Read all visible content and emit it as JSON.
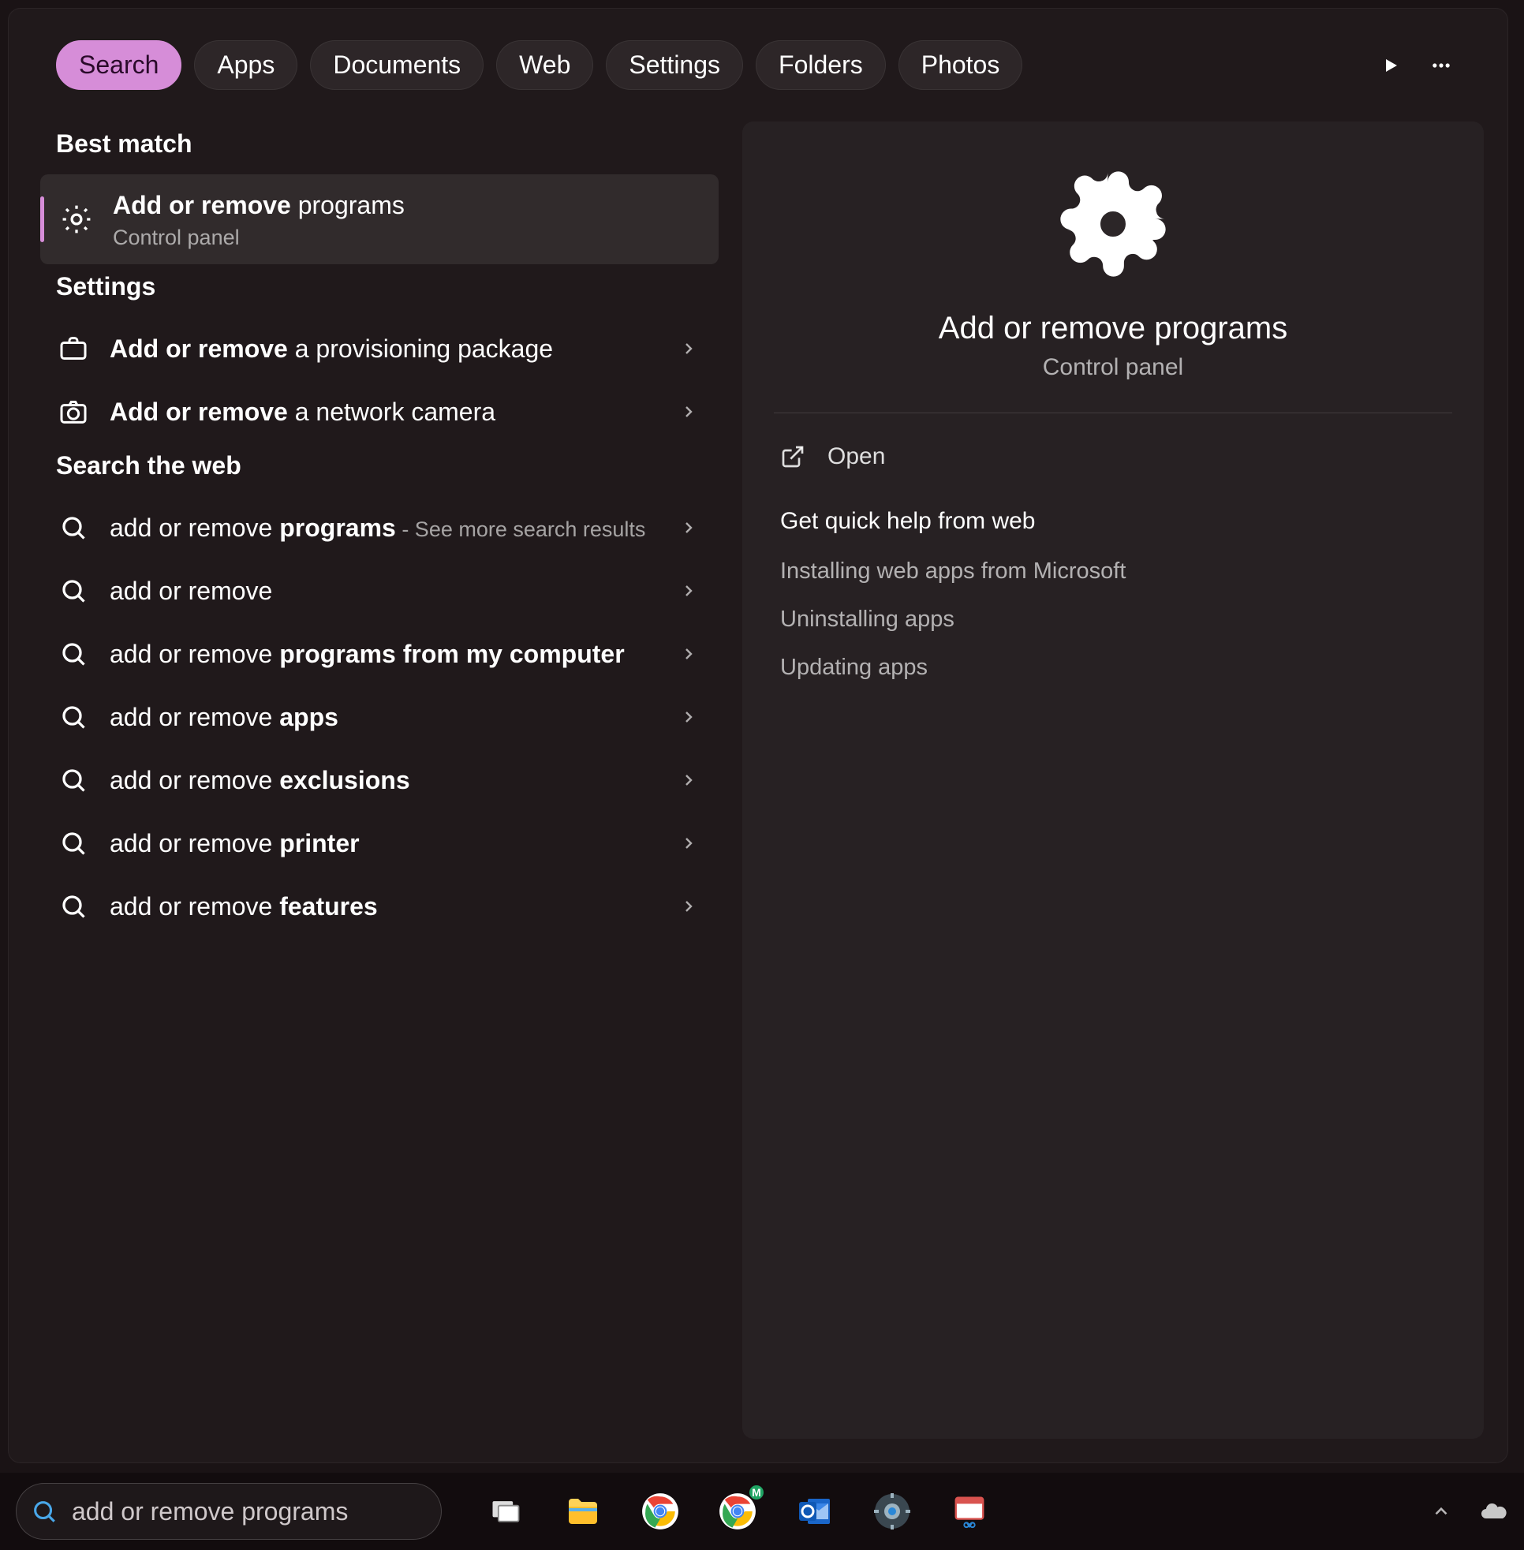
{
  "tabs": [
    "Search",
    "Apps",
    "Documents",
    "Web",
    "Settings",
    "Folders",
    "Photos"
  ],
  "active_tab_index": 0,
  "left": {
    "best_match_header": "Best match",
    "best_match": {
      "title_bold": "Add or remove",
      "title_rest": " programs",
      "subtitle": "Control panel"
    },
    "settings_header": "Settings",
    "settings_items": [
      {
        "bold": "Add or remove",
        "rest": " a provisioning package",
        "icon": "briefcase"
      },
      {
        "bold": "Add or remove",
        "rest": " a network camera",
        "icon": "camera"
      }
    ],
    "web_header": "Search the web",
    "web_items": [
      {
        "prefix": "add or remove ",
        "bold": "programs",
        "suffix": " - See more search results"
      },
      {
        "prefix": "add or remove",
        "bold": "",
        "suffix": ""
      },
      {
        "prefix": "add or remove ",
        "bold": "programs from my computer",
        "suffix": ""
      },
      {
        "prefix": "add or remove ",
        "bold": "apps",
        "suffix": ""
      },
      {
        "prefix": "add or remove ",
        "bold": "exclusions",
        "suffix": ""
      },
      {
        "prefix": "add or remove ",
        "bold": "printer",
        "suffix": ""
      },
      {
        "prefix": "add or remove ",
        "bold": "features",
        "suffix": ""
      }
    ]
  },
  "right": {
    "title": "Add or remove programs",
    "subtitle": "Control panel",
    "open_label": "Open",
    "help_header": "Get quick help from web",
    "help_links": [
      "Installing web apps from Microsoft",
      "Uninstalling apps",
      "Updating apps"
    ]
  },
  "taskbar": {
    "search_value": "add or remove programs"
  }
}
